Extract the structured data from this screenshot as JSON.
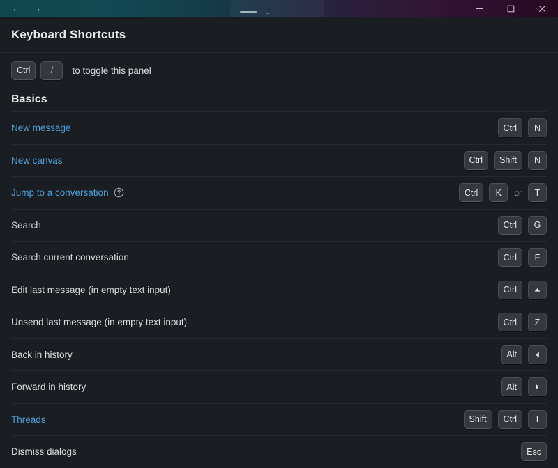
{
  "titlebar": {
    "back_icon": "arrow-left-icon",
    "forward_icon": "arrow-right-icon",
    "back_glyph": "←",
    "forward_glyph": "→",
    "minimize_label": "Minimize",
    "maximize_label": "Maximize",
    "close_label": "Close"
  },
  "panel": {
    "title": "Keyboard Shortcuts",
    "toggle_hint": {
      "keys": [
        "Ctrl",
        "/"
      ],
      "text": "to toggle this panel"
    },
    "section_title": "Basics"
  },
  "rows": [
    {
      "label": "New message",
      "link": true,
      "help": false,
      "keys": [
        "Ctrl",
        "N"
      ]
    },
    {
      "label": "New canvas",
      "link": true,
      "help": false,
      "keys": [
        "Ctrl",
        "Shift",
        "N"
      ]
    },
    {
      "label": "Jump to a conversation",
      "link": true,
      "help": true,
      "help_icon": "help-circle-icon",
      "keys": [
        "Ctrl",
        "K"
      ],
      "or_label": "or",
      "keys_alt": [
        "T"
      ]
    },
    {
      "label": "Search",
      "link": false,
      "help": false,
      "keys": [
        "Ctrl",
        "G"
      ]
    },
    {
      "label": "Search current conversation",
      "link": false,
      "help": false,
      "keys": [
        "Ctrl",
        "F"
      ]
    },
    {
      "label": "Edit last message (in empty text input)",
      "link": false,
      "help": false,
      "keys": [
        "Ctrl",
        "▲"
      ]
    },
    {
      "label": "Unsend last message (in empty text input)",
      "link": false,
      "help": false,
      "keys": [
        "Ctrl",
        "Z"
      ]
    },
    {
      "label": "Back in history",
      "link": false,
      "help": false,
      "keys": [
        "Alt",
        "◀"
      ]
    },
    {
      "label": "Forward in history",
      "link": false,
      "help": false,
      "keys": [
        "Alt",
        "▶"
      ]
    },
    {
      "label": "Threads",
      "link": true,
      "help": false,
      "keys": [
        "Shift",
        "Ctrl",
        "T"
      ]
    },
    {
      "label": "Dismiss dialogs",
      "link": false,
      "help": false,
      "keys": [
        "Esc"
      ]
    }
  ],
  "colors": {
    "background": "#1a1d21",
    "link": "#4c9ed9",
    "text": "#d7dadd",
    "key_bg": "#35383d",
    "key_border": "#4a4e54",
    "divider": "#26292d",
    "titlebar_start": "#0f4650",
    "titlebar_end": "#26091f"
  }
}
